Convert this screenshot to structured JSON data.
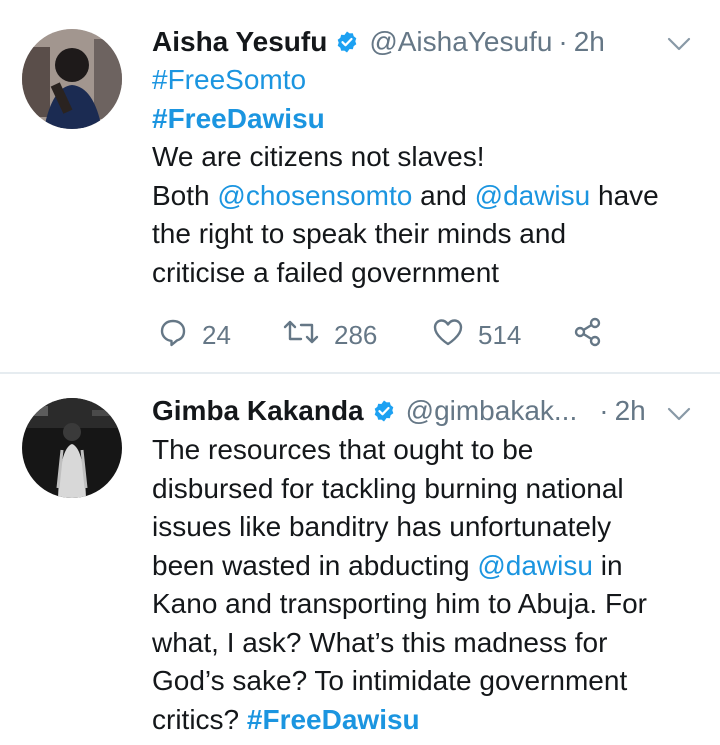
{
  "tweets": [
    {
      "name": "Aisha Yesufu",
      "handle": "@AishaYesufu",
      "separator": "·",
      "time": "2h",
      "lines": [
        [
          {
            "t": "#FreeSomto",
            "s": "link"
          }
        ],
        [
          {
            "t": "#FreeDawisu",
            "s": "hashtag-bold"
          }
        ],
        [
          {
            "t": "We are citizens not slaves!",
            "s": "text"
          }
        ],
        [
          {
            "t": "Both ",
            "s": "text"
          },
          {
            "t": "@chosensomto",
            "s": "link"
          },
          {
            "t": " and ",
            "s": "text"
          },
          {
            "t": "@dawisu",
            "s": "link"
          },
          {
            "t": " have",
            "s": "text"
          }
        ],
        [
          {
            "t": "the right to speak their minds and",
            "s": "text"
          }
        ],
        [
          {
            "t": "criticise a failed government",
            "s": "text"
          }
        ]
      ],
      "replies": "24",
      "retweets": "286",
      "likes": "514"
    },
    {
      "name": "Gimba Kakanda",
      "handle": "@gimbakak...",
      "separator": "·",
      "time": "2h",
      "lines": [
        [
          {
            "t": "The resources that ought to be",
            "s": "text"
          }
        ],
        [
          {
            "t": "disbursed for tackling burning national",
            "s": "text"
          }
        ],
        [
          {
            "t": "issues like banditry has unfortunately",
            "s": "text"
          }
        ],
        [
          {
            "t": "been wasted in abducting ",
            "s": "text"
          },
          {
            "t": "@dawisu",
            "s": "link"
          },
          {
            "t": " in",
            "s": "text"
          }
        ],
        [
          {
            "t": "Kano and transporting him to Abuja. For",
            "s": "text"
          }
        ],
        [
          {
            "t": "what, I ask? What’s this madness for",
            "s": "text"
          }
        ],
        [
          {
            "t": "God’s sake? To intimidate government",
            "s": "text"
          }
        ],
        [
          {
            "t": "critics? ",
            "s": "text"
          },
          {
            "t": "#FreeDawisu",
            "s": "hashtag-bold"
          }
        ]
      ]
    }
  ],
  "colors": {
    "link": "#1b95e0",
    "muted": "#657786",
    "text": "#14171a",
    "verified": "#1da1f2",
    "divider": "#e6ecf0"
  },
  "icons": {
    "verified": "verified-badge-icon",
    "chevron": "chevron-down-icon",
    "reply": "reply-icon",
    "retweet": "retweet-icon",
    "like": "heart-icon",
    "share": "share-icon"
  }
}
